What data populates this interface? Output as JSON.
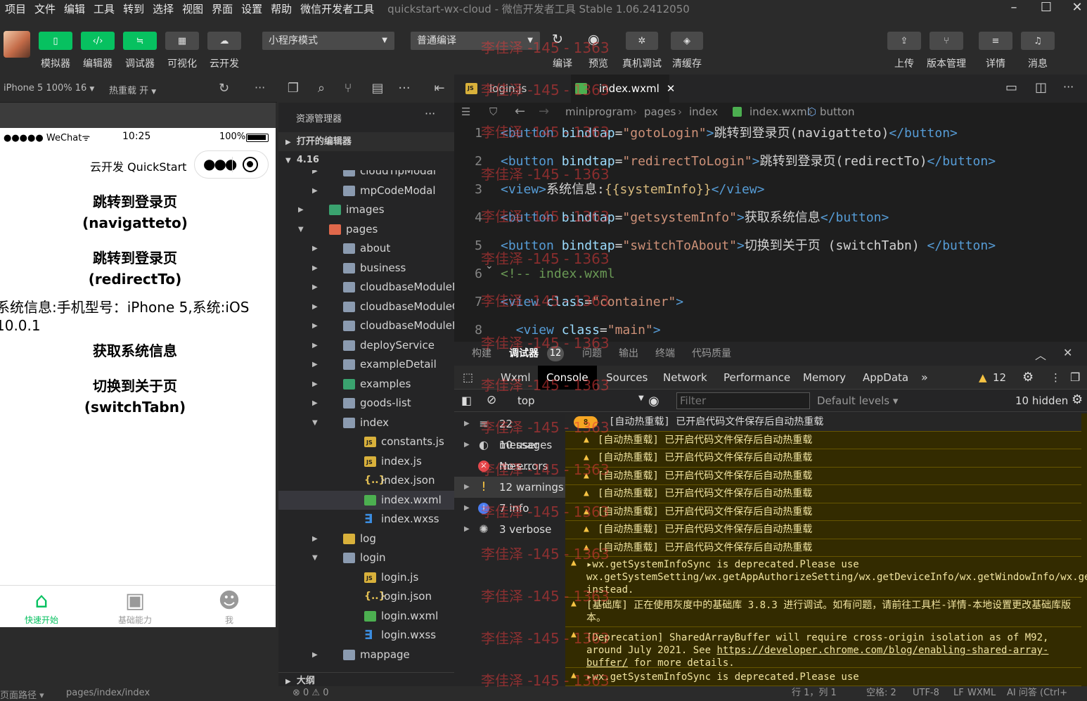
{
  "menu": [
    "项目",
    "文件",
    "编辑",
    "工具",
    "转到",
    "选择",
    "视图",
    "界面",
    "设置",
    "帮助",
    "微信开发者工具"
  ],
  "window_title": "quickstart-wx-cloud - 微信开发者工具 Stable 1.06.2412050",
  "toolbar": {
    "left_buttons": [
      {
        "label": "模拟器",
        "icon": "phone-icon",
        "active": true
      },
      {
        "label": "编辑器",
        "icon": "code-icon",
        "active": true
      },
      {
        "label": "调试器",
        "icon": "debug-icon",
        "active": true
      },
      {
        "label": "可视化",
        "icon": "layout-icon",
        "active": false
      },
      {
        "label": "云开发",
        "icon": "cloud-icon",
        "active": false
      }
    ],
    "mode_select": "小程序模式",
    "compile_select": "普通编译",
    "mid_buttons": [
      {
        "label": "编译",
        "icon": "refresh-icon"
      },
      {
        "label": "预览",
        "icon": "eye-icon"
      },
      {
        "label": "真机调试",
        "icon": "bug-icon"
      },
      {
        "label": "清缓存",
        "icon": "layers-icon"
      }
    ],
    "right_buttons": [
      {
        "label": "上传",
        "icon": "upload-icon"
      },
      {
        "label": "版本管理",
        "icon": "branch-icon"
      },
      {
        "label": "详情",
        "icon": "menu-icon"
      },
      {
        "label": "消息",
        "icon": "bell-icon"
      }
    ]
  },
  "simulator": {
    "device": "iPhone 5 100% 16",
    "hot_reload": "热重载 开",
    "status_carrier": "●●●●● WeChat",
    "status_time": "10:25",
    "status_battery": "100%",
    "nav_title": "云开发 QuickStart",
    "buttons": [
      "跳转到登录页\n(navigatteto)",
      "跳转到登录页\n(redirectTo)"
    ],
    "system_info": "系统信息:手机型号：iPhone 5,系统:iOS 10.0.1",
    "buttons2": [
      "获取系统信息",
      "切换到关于页\n(switchTabn)"
    ],
    "tabbar": [
      {
        "label": "快速开始",
        "icon": "home-icon",
        "active": true
      },
      {
        "label": "基础能力",
        "icon": "terminal-icon",
        "active": false
      },
      {
        "label": "我",
        "icon": "user-icon",
        "active": false
      }
    ],
    "footer_path_label": "页面路径",
    "footer_path": "pages/index/index"
  },
  "explorer": {
    "title": "资源管理器",
    "open_editors": "打开的编辑器",
    "root": "4.16",
    "outline": "大纲",
    "items": [
      {
        "name": "cloudTipModal",
        "type": "folder",
        "depth": 2,
        "open": false
      },
      {
        "name": "mpCodeModal",
        "type": "folder",
        "depth": 2,
        "open": false
      },
      {
        "name": "images",
        "type": "imgfolder",
        "depth": 1,
        "open": false
      },
      {
        "name": "pages",
        "type": "pagesfolder",
        "depth": 1,
        "open": true
      },
      {
        "name": "about",
        "type": "folder",
        "depth": 2,
        "open": false
      },
      {
        "name": "business",
        "type": "folder",
        "depth": 2,
        "open": false
      },
      {
        "name": "cloudbaseModuleD...",
        "type": "folder",
        "depth": 2,
        "open": false
      },
      {
        "name": "cloudbaseModuleG...",
        "type": "folder",
        "depth": 2,
        "open": false
      },
      {
        "name": "cloudbaseModuleIn...",
        "type": "folder",
        "depth": 2,
        "open": false
      },
      {
        "name": "deployService",
        "type": "folder",
        "depth": 2,
        "open": false
      },
      {
        "name": "exampleDetail",
        "type": "folder",
        "depth": 2,
        "open": false
      },
      {
        "name": "examples",
        "type": "imgfolder",
        "depth": 2,
        "open": false
      },
      {
        "name": "goods-list",
        "type": "folder",
        "depth": 2,
        "open": false
      },
      {
        "name": "index",
        "type": "folder",
        "depth": 2,
        "open": true
      },
      {
        "name": "constants.js",
        "type": "js",
        "depth": 3
      },
      {
        "name": "index.js",
        "type": "js",
        "depth": 3
      },
      {
        "name": "index.json",
        "type": "json",
        "depth": 3
      },
      {
        "name": "index.wxml",
        "type": "wxml",
        "depth": 3,
        "selected": true
      },
      {
        "name": "index.wxss",
        "type": "wxss",
        "depth": 3
      },
      {
        "name": "log",
        "type": "jsfolder",
        "depth": 2,
        "open": false
      },
      {
        "name": "login",
        "type": "folder",
        "depth": 2,
        "open": true
      },
      {
        "name": "login.js",
        "type": "js",
        "depth": 3
      },
      {
        "name": "login.json",
        "type": "json",
        "depth": 3
      },
      {
        "name": "login.wxml",
        "type": "wxml",
        "depth": 3
      },
      {
        "name": "login.wxss",
        "type": "wxss",
        "depth": 3
      },
      {
        "name": "mappage",
        "type": "folder",
        "depth": 2,
        "open": false
      }
    ]
  },
  "editor": {
    "tabs": [
      {
        "label": "login.js",
        "type": "js",
        "active": false
      },
      {
        "label": "index.wxml",
        "type": "wxml",
        "active": true
      }
    ],
    "breadcrumbs": [
      "miniprogram",
      "pages",
      "index",
      "index.wxml",
      "button"
    ],
    "lines": [
      {
        "n": "1",
        "parts": [
          [
            "tg",
            "<button "
          ],
          [
            "at",
            "bindtap"
          ],
          [
            "tx",
            "="
          ],
          [
            "st",
            "\"gotoLogin\""
          ],
          [
            "tg",
            ">"
          ],
          [
            "tx",
            "跳转到登录页(navigatteto)"
          ],
          [
            "tg",
            "</button>"
          ]
        ]
      },
      {
        "n": "2",
        "parts": [
          [
            "tg",
            "<button "
          ],
          [
            "at",
            "bindtap"
          ],
          [
            "tx",
            "="
          ],
          [
            "st",
            "\"redirectToLogin\""
          ],
          [
            "tg",
            ">"
          ],
          [
            "tx",
            "跳转到登录页(redirectTo)"
          ],
          [
            "tg",
            "</button>"
          ]
        ]
      },
      {
        "n": "3",
        "parts": [
          [
            "tg",
            "<view>"
          ],
          [
            "tx",
            "系统信息:"
          ],
          [
            "br",
            "{{systemInfo}}"
          ],
          [
            "tg",
            "</view>"
          ]
        ]
      },
      {
        "n": "4",
        "parts": [
          [
            "tg",
            "<button "
          ],
          [
            "at",
            "bindtap"
          ],
          [
            "tx",
            "="
          ],
          [
            "st",
            "\"getsystemInfo\""
          ],
          [
            "tg",
            ">"
          ],
          [
            "tx",
            "获取系统信息"
          ],
          [
            "tg",
            "</button>"
          ]
        ]
      },
      {
        "n": "5",
        "parts": [
          [
            "tg",
            "<button "
          ],
          [
            "at",
            "bindtap"
          ],
          [
            "tx",
            "="
          ],
          [
            "st",
            "\"switchToAbout\""
          ],
          [
            "tg",
            ">"
          ],
          [
            "tx",
            "切换到关于页 (switchTabn) "
          ],
          [
            "tg",
            "</button>"
          ]
        ]
      },
      {
        "n": "6",
        "parts": [
          [
            "cm",
            "<!-- index.wxml"
          ]
        ]
      },
      {
        "n": "7",
        "parts": [
          [
            "tg",
            "<view "
          ],
          [
            "at",
            "class"
          ],
          [
            "tx",
            "="
          ],
          [
            "st",
            "\"container\""
          ],
          [
            "tg",
            ">"
          ]
        ]
      },
      {
        "n": "8",
        "parts": [
          [
            "tx",
            "  "
          ],
          [
            "tg",
            "<view "
          ],
          [
            "at",
            "class"
          ],
          [
            "tx",
            "="
          ],
          [
            "st",
            "\"main\""
          ],
          [
            "tg",
            ">"
          ]
        ]
      }
    ]
  },
  "panel": {
    "tabs": [
      "构建",
      "调试器",
      "问题",
      "输出",
      "终端",
      "代码质量"
    ],
    "debug_badge": "12",
    "devtools_tabs": [
      "Wxml",
      "Console",
      "Sources",
      "Network",
      "Performance",
      "Memory",
      "AppData"
    ],
    "warn_count": "12",
    "context": "top",
    "filter_placeholder": "Filter",
    "levels": "Default levels",
    "hidden": "10 hidden",
    "sidebar": [
      {
        "label": "22 messages",
        "icon": "list-icon",
        "color": "#ddd",
        "expandable": true
      },
      {
        "label": "10 user mes...",
        "icon": "user-circle-icon",
        "color": "#ddd",
        "expandable": true
      },
      {
        "label": "No errors",
        "icon": "error-icon",
        "color": "#e5484d",
        "expandable": false
      },
      {
        "label": "12 warnings",
        "icon": "warning-icon",
        "color": "#f6c343",
        "expandable": true,
        "selected": true
      },
      {
        "label": "7 info",
        "icon": "info-icon",
        "color": "#4a7cf0",
        "expandable": true
      },
      {
        "label": "3 verbose",
        "icon": "gear-bug-icon",
        "color": "#aaa",
        "expandable": true
      }
    ],
    "repeat_count": "8",
    "logs": [
      "[自动热重载] 已开启代码文件保存后自动热重载",
      "[自动热重载] 已开启代码文件保存后自动热重载",
      "[自动热重载] 已开启代码文件保存后自动热重载",
      "[自动热重载] 已开启代码文件保存后自动热重载",
      "[自动热重载] 已开启代码文件保存后自动热重载",
      "[自动热重载] 已开启代码文件保存后自动热重载",
      "[自动热重载] 已开启代码文件保存后自动热重载",
      "[自动热重载] 已开启代码文件保存后自动热重载"
    ],
    "log_deprecated": "▸wx.getSystemInfoSync is deprecated.Please use wx.getSystemSetting/wx.getAppAuthorizeSetting/wx.getDeviceInfo/wx.getWindowInfo/wx.getAppBaseInfo instead.",
    "log_baseline": "[基础库] 正在使用灰度中的基础库 3.8.3 进行调试。如有问题，请前往工具栏-详情-本地设置更改基础库版本。",
    "log_sab_pre": "[Deprecation] SharedArrayBuffer will require cross-origin isolation as of M92, around July 2021. See ",
    "log_sab_link": "https://developer.chrome.com/blog/enabling-shared-array-buffer/",
    "log_sab_post": " for more details.",
    "log_last": "▸wx.getSystemInfoSync is deprecated.Please use"
  },
  "statusbar": {
    "errors": "⊗ 0 ⚠ 0",
    "position": "行 1，列 1",
    "spaces": "空格: 2",
    "encoding": "UTF-8",
    "eol": "LF",
    "lang": "WXML",
    "ai": "AI 问答 (Ctrl+"
  },
  "watermark": "李佳泽 -145 - 1363"
}
